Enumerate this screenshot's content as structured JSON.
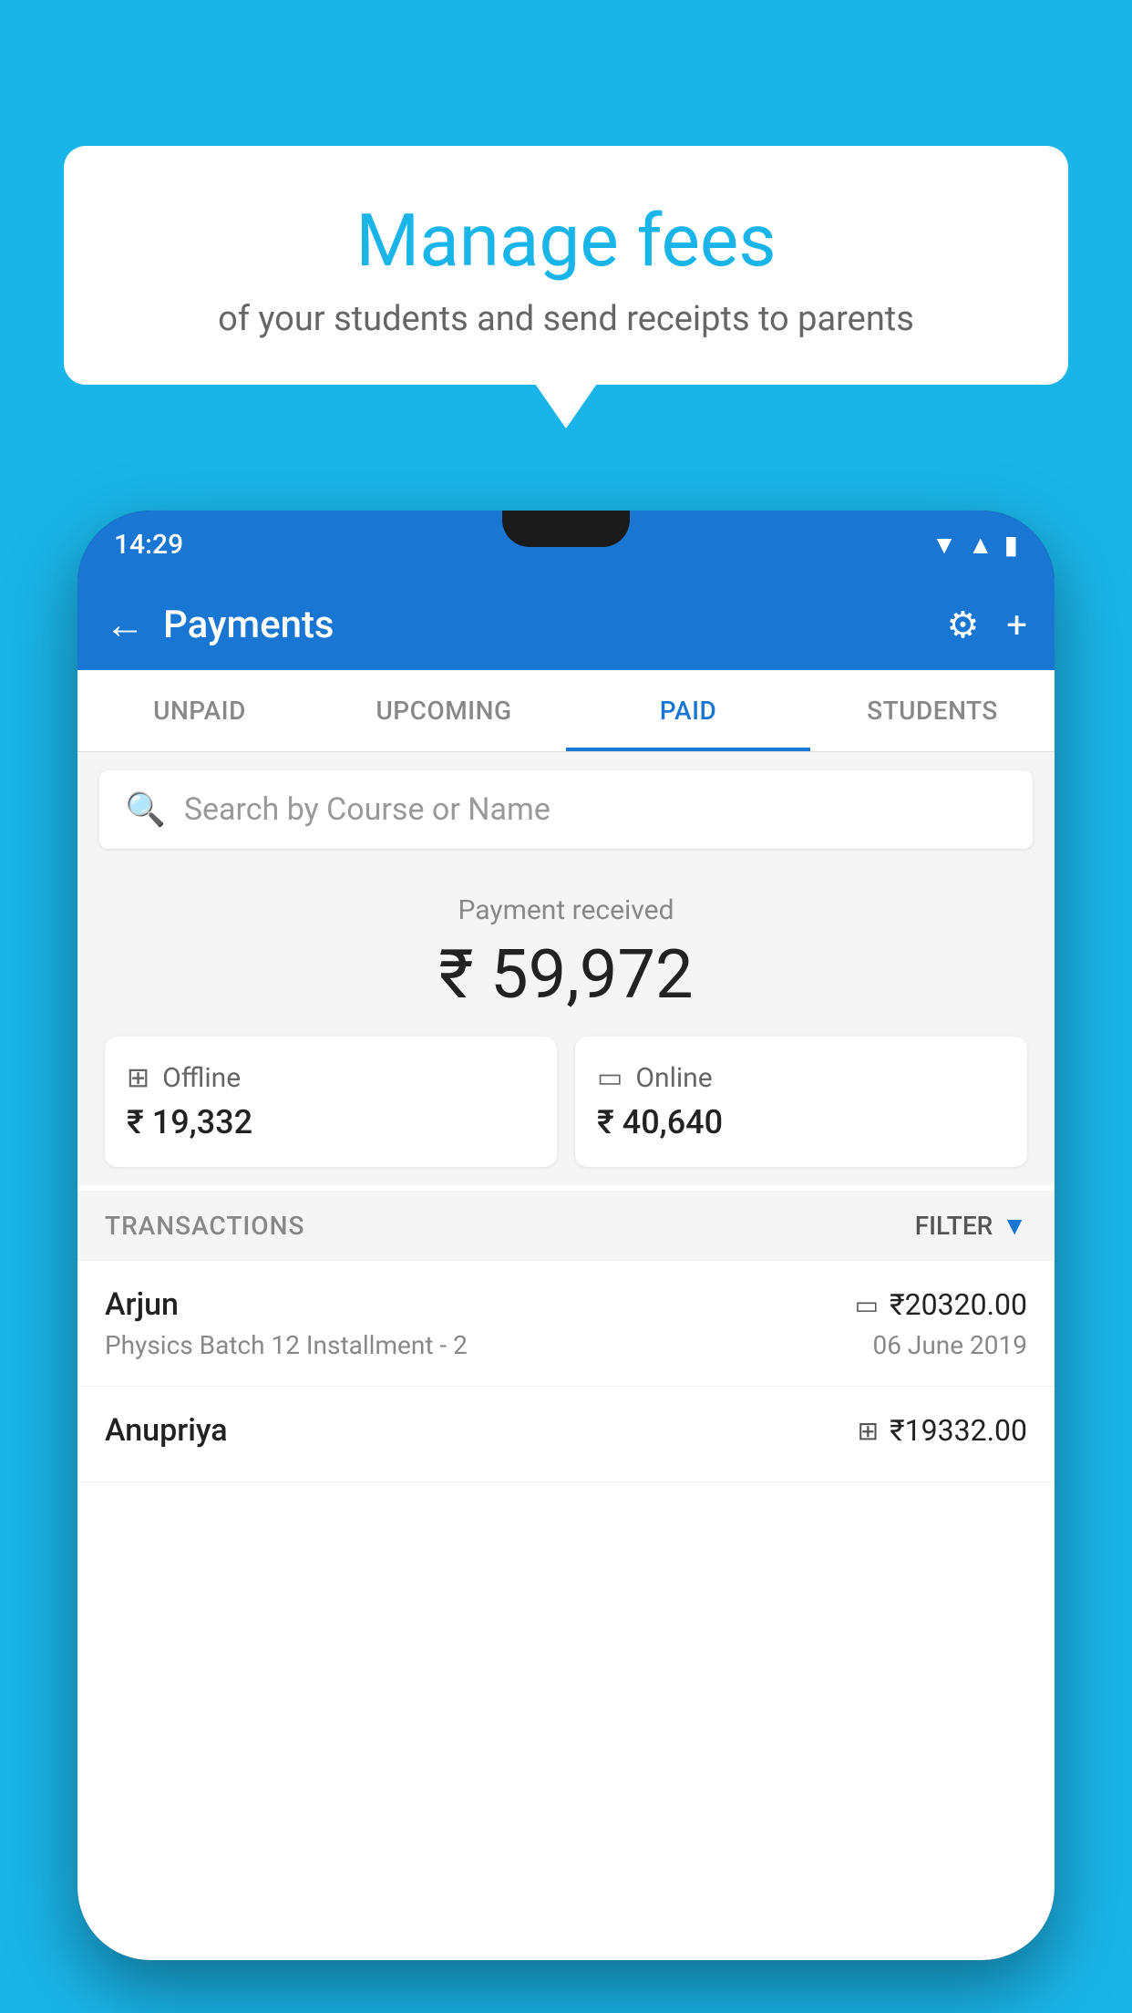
{
  "background_color": "#1ab5e8",
  "speech_bubble": {
    "title": "Manage fees",
    "subtitle": "of your students and send receipts to parents"
  },
  "phone": {
    "status_bar": {
      "time": "14:29"
    },
    "header": {
      "title": "Payments",
      "back_label": "←",
      "settings_label": "⚙",
      "add_label": "+"
    },
    "tabs": [
      {
        "label": "UNPAID",
        "active": false
      },
      {
        "label": "UPCOMING",
        "active": false
      },
      {
        "label": "PAID",
        "active": true
      },
      {
        "label": "STUDENTS",
        "active": false
      }
    ],
    "search": {
      "placeholder": "Search by Course or Name"
    },
    "payment_summary": {
      "label": "Payment received",
      "amount": "₹ 59,972",
      "offline": {
        "label": "Offline",
        "amount": "₹ 19,332"
      },
      "online": {
        "label": "Online",
        "amount": "₹ 40,640"
      }
    },
    "transactions": {
      "header_label": "TRANSACTIONS",
      "filter_label": "FILTER",
      "items": [
        {
          "name": "Arjun",
          "course": "Physics Batch 12 Installment - 2",
          "amount": "₹20320.00",
          "date": "06 June 2019",
          "payment_type": "online"
        },
        {
          "name": "Anupriya",
          "course": "",
          "amount": "₹19332.00",
          "date": "",
          "payment_type": "offline"
        }
      ]
    }
  }
}
